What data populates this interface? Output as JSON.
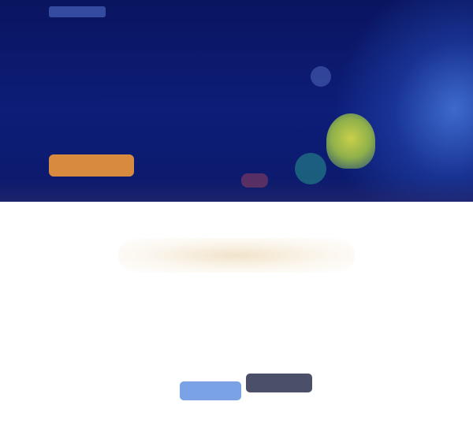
{
  "nav": {
    "logo_text": "",
    "items": [
      "",
      "",
      "",
      ""
    ]
  },
  "hero": {
    "title": "",
    "subtitle": "",
    "cta_label": "",
    "secondary_label": ""
  },
  "banner": {
    "text": ""
  },
  "features": [
    {
      "title": "",
      "desc": ""
    },
    {
      "title": "",
      "desc": ""
    },
    {
      "title": "",
      "desc": ""
    },
    {
      "title": "",
      "desc": ""
    },
    {
      "title": "",
      "desc": ""
    },
    {
      "title": "",
      "desc": ""
    }
  ],
  "actions": {
    "primary_label": "",
    "secondary_label": ""
  },
  "colors": {
    "hero_bg": "#0d1d78",
    "cta": "#d88a3f",
    "primary_button": "#7aa3e6",
    "secondary_button": "#4b5068"
  }
}
